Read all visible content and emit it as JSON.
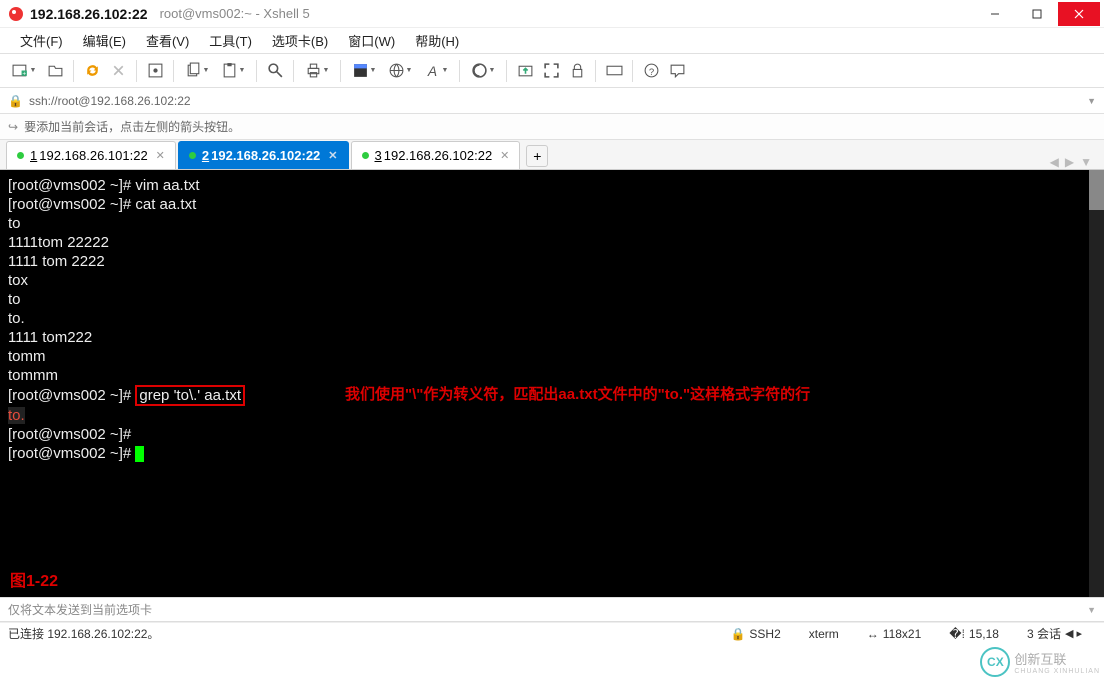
{
  "title": {
    "ip": "192.168.26.102:22",
    "sub": "root@vms002:~ - Xshell 5"
  },
  "menu": {
    "file": "文件(F)",
    "edit": "编辑(E)",
    "view": "查看(V)",
    "tools": "工具(T)",
    "tabs": "选项卡(B)",
    "window": "窗口(W)",
    "help": "帮助(H)"
  },
  "address": {
    "url": "ssh://root@192.168.26.102:22"
  },
  "hint": {
    "text": "要添加当前会话，点击左侧的箭头按钮。"
  },
  "tabs": {
    "list": [
      {
        "num": "1",
        "label": "192.168.26.101:22",
        "active": false
      },
      {
        "num": "2",
        "label": "192.168.26.102:22",
        "active": true
      },
      {
        "num": "3",
        "label": "192.168.26.102:22",
        "active": false
      }
    ]
  },
  "term": {
    "l1": "[root@vms002 ~]# vim aa.txt",
    "l2": "[root@vms002 ~]# cat aa.txt",
    "l3": "to",
    "l4": "1111tom 22222",
    "l5": "1111 tom 2222",
    "l6": "tox",
    "l7": "to",
    "l8": "to.",
    "l9": "1111 tom222",
    "l10": "tomm",
    "l11": "tommm",
    "l12a": "[root@vms002 ~]# ",
    "l12cmd": "grep 'to\\.' aa.txt",
    "l13": "to.",
    "l14": "[root@vms002 ~]#",
    "l15": "[root@vms002 ~]# ",
    "annotation": "我们使用\"\\\"作为转义符，匹配出aa.txt文件中的\"to.\"这样格式字符的行",
    "figlabel": "图1-22"
  },
  "inputbar": {
    "ph": "仅将文本发送到当前选项卡"
  },
  "status": {
    "conn": "已连接 192.168.26.102:22。",
    "ssh": "SSH2",
    "term": "xterm",
    "size": "118x21",
    "pos": "15,18",
    "sess": "3 会话"
  },
  "watermark": {
    "logo": "CX",
    "main": "创新互联",
    "sub": "CHUANG XINHULIAN"
  }
}
